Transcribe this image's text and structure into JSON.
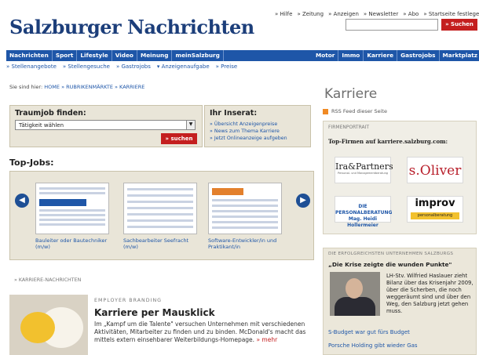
{
  "header": {
    "logo": "Salzburger Nachrichten",
    "top_links": [
      "» Hilfe",
      "» Zeitung",
      "» Anzeigen",
      "» Newsletter",
      "» Abo",
      "» Startseite festlegen"
    ],
    "search_button": "» Suchen"
  },
  "nav": {
    "left": [
      "Nachrichten",
      "Sport",
      "Lifestyle",
      "Video",
      "Meinung",
      "meinSalzburg"
    ],
    "right": [
      "Motor",
      "Immo",
      "Karriere",
      "Gastrojobs",
      "Marktplatz"
    ]
  },
  "subnav": [
    "» Stellenangebote",
    "» Stellengesuche",
    "» Gastrojobs",
    "▾ Anzeigenaufgabe",
    "» Preise"
  ],
  "breadcrumb": {
    "prefix": "Sie sind hier:",
    "items": [
      "HOME",
      "» RUBRIKENMÄRKTE",
      "» KARRIERE"
    ]
  },
  "traumjob": {
    "title": "Traumjob finden:",
    "select_value": "Tätigkeit wählen",
    "button": "» suchen"
  },
  "inserat": {
    "title": "Ihr Inserat:",
    "links": [
      "» Übersicht Anzeigenpreise",
      "» News zum Thema Karriere",
      "» Jetzt Onlineanzeige aufgeben"
    ]
  },
  "topjobs": {
    "title": "Top-Jobs:",
    "jobs": [
      {
        "caption": "Bauleiter oder Bautechniker (m/w)"
      },
      {
        "caption": "Sachbearbeiter Seefracht (m/w)"
      },
      {
        "caption": "Software-Entwickler/in und Praktikant/in"
      }
    ]
  },
  "news": {
    "heading": "» KARRIERE-NACHRICHTEN",
    "kicker": "EMPLOYER BRANDING",
    "title": "Karriere per Mausklick",
    "text": "Im „Kampf um die Talente\" versuchen Unternehmen mit verschiedenen Aktivitäten, Mitarbeiter zu finden und zu binden. McDonald's macht das mittels extern einsehbarer Weiterbildungs-Homepage.",
    "more": "» mehr"
  },
  "sidebar": {
    "title": "Karriere",
    "rss": "RSS Feed dieser Seite",
    "firmen_head": "FIRMENPORTRAIT",
    "firmen_sub": "Top-Firmen auf karriere.salzburg.com:",
    "logos": {
      "ip": "Ira&Partners",
      "ip_sub": "Personal- und Managementberatung",
      "soliver": "s.Oliver",
      "pb1": "DIE PERSONALBERATUNG",
      "pb2": "Mag. Heidi Hollermeier",
      "improv": "improv",
      "improv_sub": "personalberatung"
    },
    "eu_head": "DIE ERFOLGREICHSTEN UNTERNEHMEN SALZBURGS",
    "eu_quote": "„Die Krise zeigte die wunden Punkte\"",
    "eu_text": "LH-Stv. Wilfried Haslauer zieht Bilanz über das Krisenjahr 2009, über die Scherben, die noch weggeräumt sind und über den Weg, den Salzburg jetzt gehen muss.",
    "eu_links": [
      "S-Budget war gut fürs Budget",
      "Porsche Holding gibt wieder Gas"
    ]
  }
}
